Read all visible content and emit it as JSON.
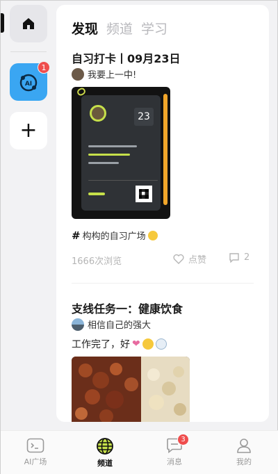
{
  "rail": {
    "ai_badge": "1",
    "ai_label": "AI",
    "add_symbol": "+"
  },
  "tabs": [
    {
      "label": "发现",
      "active": true
    },
    {
      "label": "频道",
      "active": false
    },
    {
      "label": "学习",
      "active": false
    }
  ],
  "posts": [
    {
      "title": "自习打卡丨09月23日",
      "author": "我要上一中!",
      "image_date": "23",
      "hashtag": "构构的自习广场",
      "views": "1666次浏览",
      "like_label": "点赞",
      "comment_count": "2"
    },
    {
      "title": "支线任务一：健康饮食",
      "author": "相信自己的强大",
      "body": "工作完了，好"
    }
  ],
  "bottom_nav": [
    {
      "label": "AI广场",
      "icon": "terminal-icon",
      "active": false
    },
    {
      "label": "频道",
      "icon": "globe-icon",
      "active": true
    },
    {
      "label": "消息",
      "icon": "chat-icon",
      "active": false,
      "badge": "3"
    },
    {
      "label": "我的",
      "icon": "person-icon",
      "active": false
    }
  ],
  "colors": {
    "accent_blue": "#3aa6f2",
    "badge_red": "#ef4d4d",
    "active_green": "#c6e04a"
  }
}
